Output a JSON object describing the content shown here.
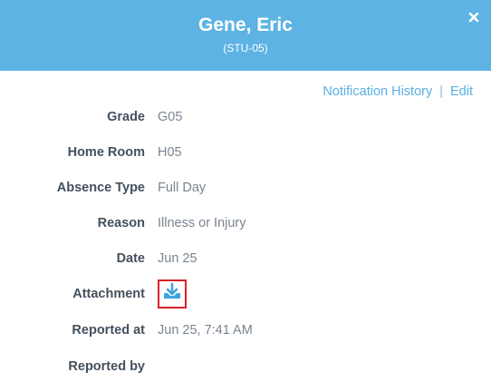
{
  "header": {
    "name": "Gene, Eric",
    "student_id": "(STU-05)"
  },
  "links": {
    "notification_history": "Notification History",
    "separator": "|",
    "edit": "Edit"
  },
  "details": [
    {
      "label": "Grade",
      "value": "G05"
    },
    {
      "label": "Home Room",
      "value": "H05"
    },
    {
      "label": "Absence Type",
      "value": "Full Day"
    },
    {
      "label": "Reason",
      "value": "Illness or Injury"
    },
    {
      "label": "Date",
      "value": "Jun 25"
    },
    {
      "label": "Attachment",
      "value": ""
    },
    {
      "label": "Reported at",
      "value": "Jun 25, 7:41 AM"
    },
    {
      "label": "Reported by",
      "value": ""
    }
  ],
  "icons": {
    "close": "close-icon",
    "attachment": "download-icon"
  },
  "colors": {
    "header_bg": "#5db3e4",
    "link": "#5aaee0",
    "label": "#44505d",
    "value": "#7a8490",
    "highlight": "#d9242a"
  }
}
